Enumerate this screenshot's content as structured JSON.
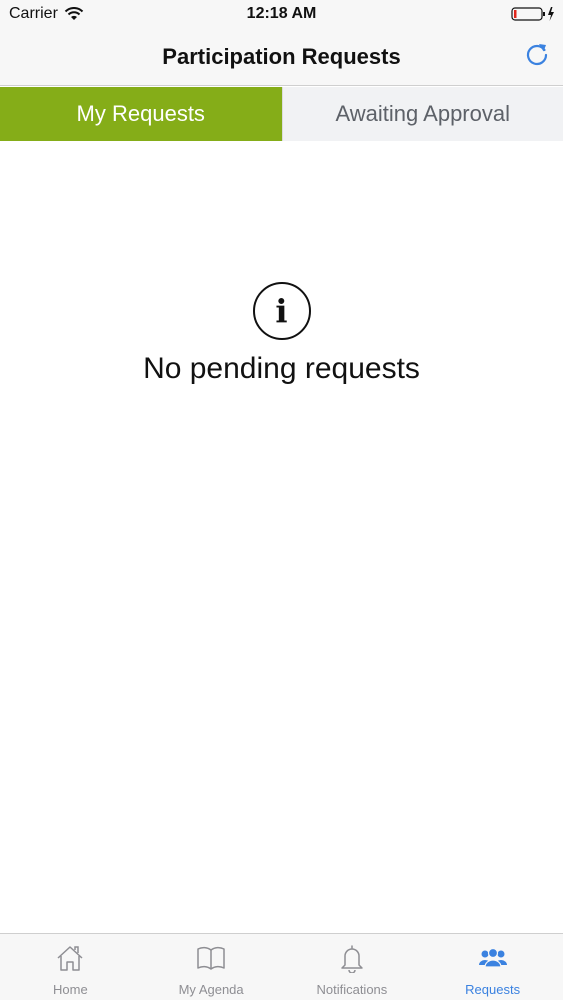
{
  "status_bar": {
    "carrier": "Carrier",
    "time": "12:18 AM"
  },
  "nav": {
    "title": "Participation Requests",
    "refresh_icon": "refresh-icon"
  },
  "tabs": [
    {
      "label": "My Requests",
      "active": true
    },
    {
      "label": "Awaiting Approval",
      "active": false
    }
  ],
  "empty_state": {
    "icon": "info-icon",
    "icon_glyph": "i",
    "message": "No pending requests"
  },
  "tab_bar": {
    "items": [
      {
        "label": "Home",
        "icon": "home-icon",
        "active": false
      },
      {
        "label": "My Agenda",
        "icon": "book-icon",
        "active": false
      },
      {
        "label": "Notifications",
        "icon": "bell-icon",
        "active": false
      },
      {
        "label": "Requests",
        "icon": "users-icon",
        "active": true
      }
    ]
  },
  "colors": {
    "accent_green": "#85ad18",
    "active_blue": "#3b82e0",
    "inactive_gray": "#8e8e93"
  }
}
